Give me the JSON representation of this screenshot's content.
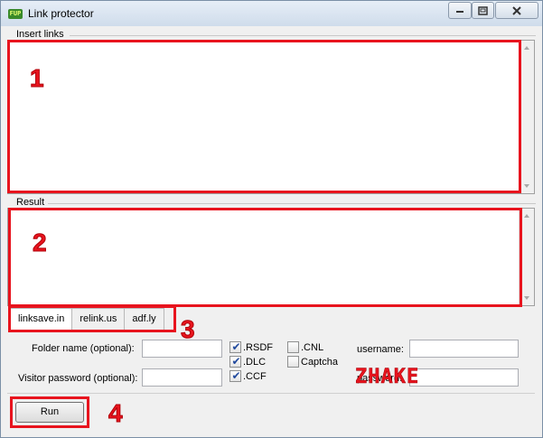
{
  "window": {
    "title": "Link protector",
    "app_icon_text": "FUP"
  },
  "insert_links": {
    "label": "Insert links",
    "value": "",
    "badge": "1"
  },
  "result": {
    "label": "Result",
    "value": "",
    "badge": "2"
  },
  "tabs": {
    "items": [
      {
        "label": "linksave.in",
        "selected": true
      },
      {
        "label": "relink.us",
        "selected": false
      },
      {
        "label": "adf.ly",
        "selected": false
      }
    ],
    "badge": "3"
  },
  "options": {
    "folder_name_label": "Folder name (optional):",
    "folder_name_value": "",
    "visitor_password_label": "Visitor password (optional):",
    "visitor_password_value": "",
    "checkboxes": [
      {
        "label": ".RSDF",
        "checked": true
      },
      {
        "label": ".DLC",
        "checked": true
      },
      {
        "label": ".CCF",
        "checked": true
      },
      {
        "label": ".CNL",
        "checked": false
      },
      {
        "label": "Captcha",
        "checked": false
      }
    ],
    "username_label": "username:",
    "username_value": "",
    "password_label": "password:",
    "password_value": ""
  },
  "run": {
    "label": "Run",
    "badge": "4"
  },
  "watermark": "ZHAKE",
  "colors": {
    "annotation_red": "#e8141e",
    "window_bg": "#f0f0f0",
    "titlebar": "#dbe5f1"
  }
}
